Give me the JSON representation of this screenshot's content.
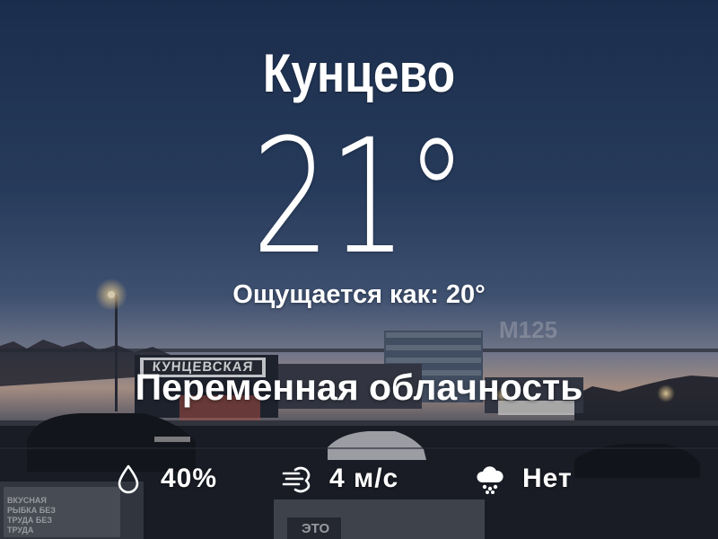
{
  "weather": {
    "city": "Кунцево",
    "temperature": "21°",
    "feels_like_label": "Ощущается как:",
    "feels_like_value": "20°",
    "condition": "Переменная облачность",
    "humidity": "40%",
    "wind": "4 м/с",
    "precipitation": "Нет"
  },
  "background": {
    "station_sign": "КУНЦЕВСКАЯ",
    "billboard_text": "М125",
    "ad_text": "ВКУСНАЯ РЫБКА БЕЗ ТРУДА БЕЗ ТРУДА",
    "bottom_sign": "ЭТО"
  },
  "icons": {
    "humidity": "droplet-icon",
    "wind": "wind-icon",
    "precipitation": "snow-cloud-icon"
  },
  "colors": {
    "sky_top": "#21375a",
    "sky_mid": "#3c5479",
    "horizon": "#c8a694",
    "text": "#ffffff"
  }
}
